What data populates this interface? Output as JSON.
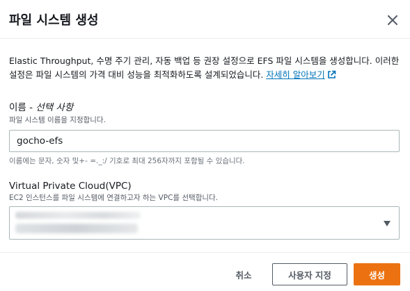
{
  "modal": {
    "title": "파일 시스템 생성",
    "close_icon": "close-icon"
  },
  "description": {
    "text": "Elastic Throughput, 수명 주기 관리, 자동 백업 등 권장 설정으로 EFS 파일 시스템을 생성합니다. 이러한 설정은 파일 시스템의 가격 대비 성능을 최적화하도록 설계되었습니다. ",
    "link_label": "자세히 알아보기",
    "link_icon": "external-link-icon"
  },
  "name_field": {
    "label": "이름 - ",
    "label_optional": "선택 사항",
    "sublabel": "파일 시스템 이름을 지정합니다.",
    "value": "gocho-efs",
    "hint": "이름에는 문자, 숫자 및+- =._:/ 기호로 최대 256자까지 포함될 수 있습니다."
  },
  "vpc_field": {
    "label": "Virtual Private Cloud(VPC)",
    "sublabel": "EC2 인스턴스를 파일 시스템에 연결하고자 하는 VPC를 선택합니다.",
    "dropdown_icon": "caret-down-icon"
  },
  "footer": {
    "cancel_label": "취소",
    "customize_label": "사용자 지정",
    "create_label": "생성"
  },
  "colors": {
    "primary_button": "#ec7211",
    "link": "#0073bb",
    "text": "#16191f",
    "border": "#aab7b8"
  }
}
